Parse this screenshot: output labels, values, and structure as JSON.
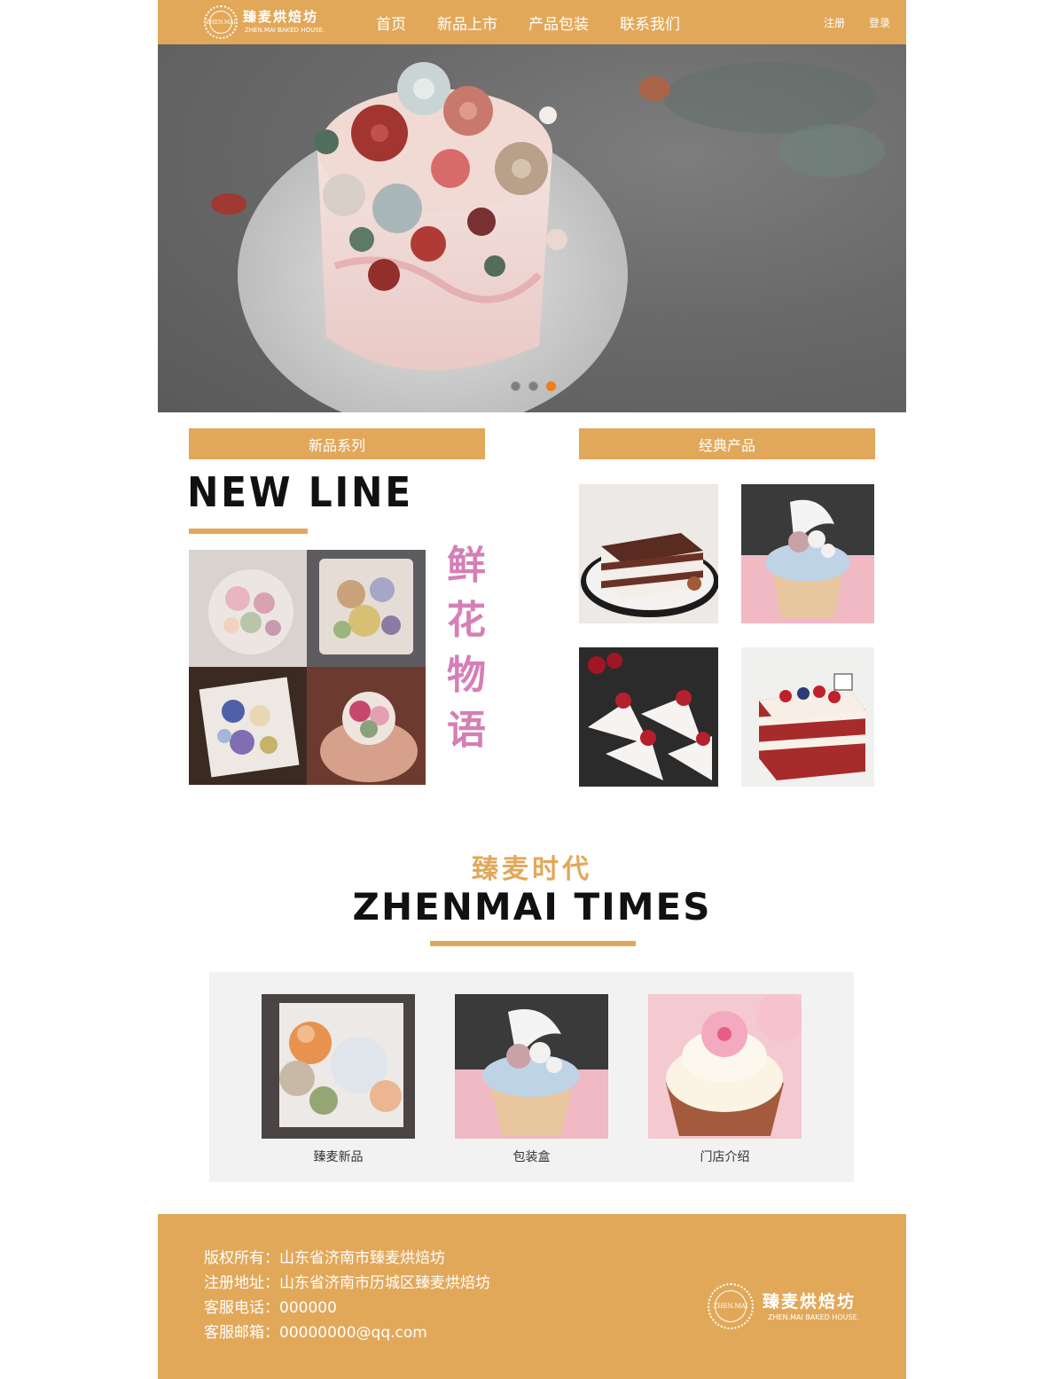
{
  "header": {
    "logo_text": "臻麦烘焙坊",
    "logo_sub": "ZHEN.MAI BAKED HOUSE.",
    "logo_badge": "ZHEN.MAI",
    "nav": [
      "首页",
      "新品上市",
      "产品包装",
      "联系我们"
    ],
    "auth": {
      "register": "注册",
      "login": "登录"
    }
  },
  "banner": {
    "slides": 3,
    "active_slide": 3
  },
  "new_series": {
    "bar_label": "新品系列",
    "title": "NEW LINE",
    "vertical_text": [
      "鲜",
      "花",
      "物",
      "语"
    ]
  },
  "classic": {
    "bar_label": "经典产品"
  },
  "times": {
    "title_cn": "臻麦时代",
    "title_en": "ZHENMAI TIMES",
    "cards": [
      {
        "label": "臻麦新品"
      },
      {
        "label": "包装盒"
      },
      {
        "label": "门店介绍"
      }
    ]
  },
  "footer": {
    "lines": [
      "版权所有：山东省济南市臻麦烘焙坊",
      "注册地址：山东省济南市历城区臻麦烘焙坊",
      "客服电话：000000",
      "客服邮箱：00000000@qq.com"
    ],
    "logo_text": "臻麦烘焙坊",
    "logo_sub": "ZHEN.MAI BAKED HOUSE."
  },
  "colors": {
    "accent": "#e2a85a",
    "active_dot": "#f07d1a",
    "pink_text": "#d57fb7"
  }
}
